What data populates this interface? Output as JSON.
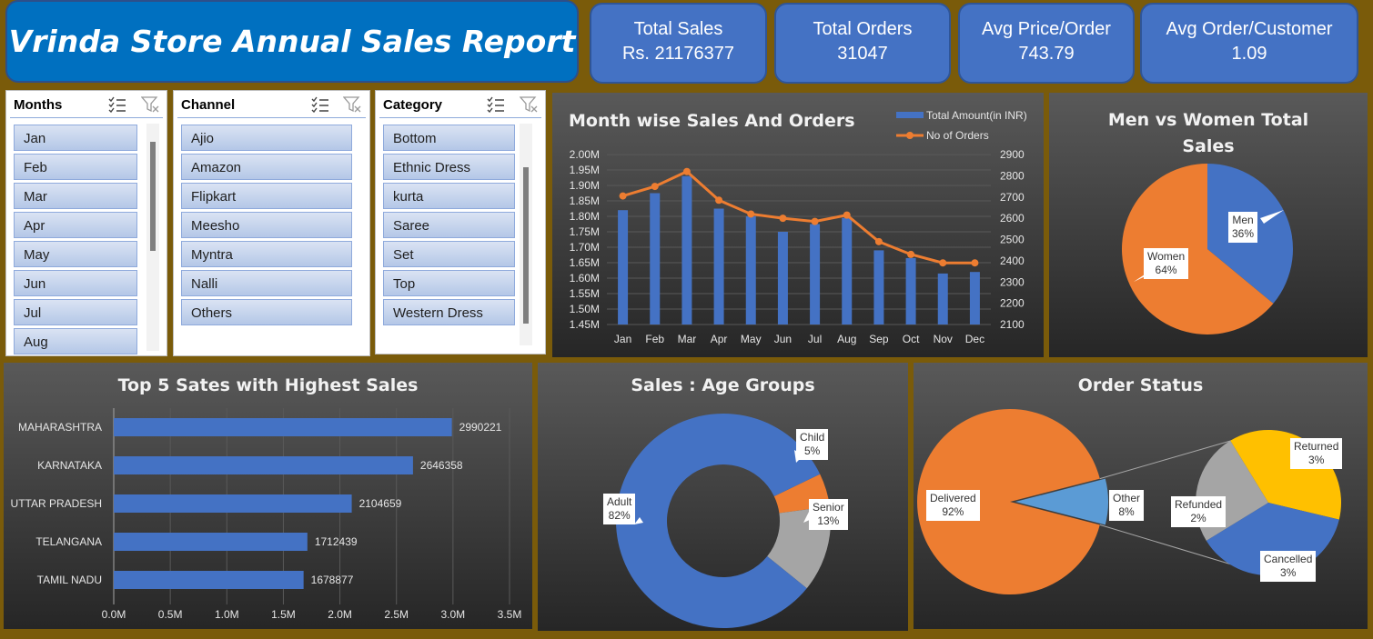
{
  "title": "Vrinda Store Annual Sales Report",
  "kpis": [
    {
      "label": "Total Sales",
      "value": "Rs. 21176377"
    },
    {
      "label": "Total Orders",
      "value": "31047"
    },
    {
      "label": "Avg Price/Order",
      "value": "743.79"
    },
    {
      "label": "Avg Order/Customer",
      "value": "1.09"
    }
  ],
  "slicers": {
    "months": {
      "title": "Months",
      "items": [
        "Jan",
        "Feb",
        "Mar",
        "Apr",
        "May",
        "Jun",
        "Jul",
        "Aug"
      ]
    },
    "channel": {
      "title": "Channel",
      "items": [
        "Ajio",
        "Amazon",
        "Flipkart",
        "Meesho",
        "Myntra",
        "Nalli",
        "Others"
      ]
    },
    "category": {
      "title": "Category",
      "items": [
        "Bottom",
        "Ethnic Dress",
        "kurta",
        "Saree",
        "Set",
        "Top",
        "Western Dress"
      ]
    }
  },
  "colors": {
    "blue": "#4472c4",
    "orange": "#ed7d31",
    "gray": "#a5a5a5",
    "yellow": "#ffc000",
    "lightblue": "#5b9bd5"
  },
  "chart_data": [
    {
      "type": "bar",
      "title": "Month wise Sales And Orders",
      "categories": [
        "Jan",
        "Feb",
        "Mar",
        "Apr",
        "May",
        "Jun",
        "Jul",
        "Aug",
        "Sep",
        "Oct",
        "Nov",
        "Dec"
      ],
      "series": [
        {
          "name": "Total Amount(in INR)",
          "axis": "left",
          "values": [
            1820000,
            1875000,
            1930000,
            1825000,
            1800000,
            1750000,
            1775000,
            1795000,
            1690000,
            1665000,
            1615000,
            1620000
          ]
        },
        {
          "name": "No of Orders",
          "axis": "right",
          "type": "line",
          "values": [
            2705,
            2750,
            2820,
            2685,
            2620,
            2600,
            2585,
            2615,
            2490,
            2430,
            2390,
            2390
          ]
        }
      ],
      "y_left_ticks": [
        "1.45M",
        "1.50M",
        "1.55M",
        "1.60M",
        "1.65M",
        "1.70M",
        "1.75M",
        "1.80M",
        "1.85M",
        "1.90M",
        "1.95M",
        "2.00M"
      ],
      "ylim_left": [
        1450000,
        2000000
      ],
      "y_right_ticks": [
        "2100",
        "2200",
        "2300",
        "2400",
        "2500",
        "2600",
        "2700",
        "2800",
        "2900"
      ],
      "ylim_right": [
        2100,
        2900
      ],
      "legend": "top-right"
    },
    {
      "type": "pie",
      "title": "Men vs Women Total Sales",
      "slices": [
        {
          "label": "Men",
          "pct": "36%",
          "value": 36
        },
        {
          "label": "Women",
          "pct": "64%",
          "value": 64
        }
      ]
    },
    {
      "type": "bar",
      "orientation": "horizontal",
      "title": "Top 5 Sates with Highest Sales",
      "categories": [
        "MAHARASHTRA",
        "KARNATAKA",
        "UTTAR PRADESH",
        "TELANGANA",
        "TAMIL NADU"
      ],
      "values": [
        2990221,
        2646358,
        2104659,
        1712439,
        1678877
      ],
      "x_ticks": [
        "0.0M",
        "0.5M",
        "1.0M",
        "1.5M",
        "2.0M",
        "2.5M",
        "3.0M",
        "3.5M"
      ],
      "xlim": [
        0,
        3500000
      ]
    },
    {
      "type": "pie",
      "style": "doughnut",
      "title": "Sales : Age Groups",
      "slices": [
        {
          "label": "Adult",
          "pct": "82%",
          "value": 82
        },
        {
          "label": "Child",
          "pct": "5%",
          "value": 5
        },
        {
          "label": "Senior",
          "pct": "13%",
          "value": 13
        }
      ]
    },
    {
      "type": "pie",
      "style": "pie-of-pie",
      "title": "Order Status",
      "slices": [
        {
          "label": "Delivered",
          "pct": "92%",
          "value": 92
        },
        {
          "label": "Other",
          "pct": "8%",
          "value": 8
        }
      ],
      "secondary": [
        {
          "label": "Returned",
          "pct": "3%",
          "value": 3
        },
        {
          "label": "Cancelled",
          "pct": "3%",
          "value": 3
        },
        {
          "label": "Refunded",
          "pct": "2%",
          "value": 2
        }
      ]
    }
  ]
}
